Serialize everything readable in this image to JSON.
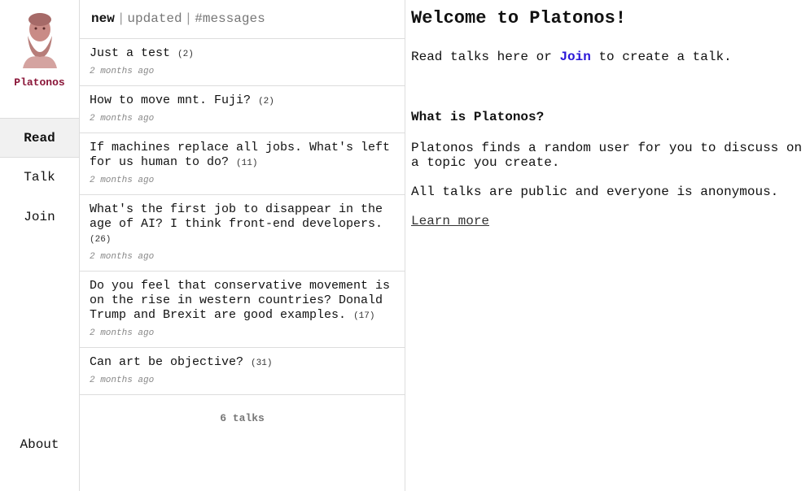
{
  "sidebar": {
    "brand": "Platonos",
    "nav": [
      {
        "label": "Read"
      },
      {
        "label": "Talk"
      },
      {
        "label": "Join"
      }
    ],
    "about": "About"
  },
  "tabs": {
    "new": "new",
    "updated": "updated",
    "messages": "#messages",
    "separator": "|"
  },
  "talks": [
    {
      "title": "Just a test",
      "count": "(2)",
      "time": "2 months ago"
    },
    {
      "title": "How to move mnt. Fuji?",
      "count": "(2)",
      "time": "2 months ago"
    },
    {
      "title": "If machines replace all jobs. What's left for us human to do?",
      "count": "(11)",
      "time": "2 months ago"
    },
    {
      "title": "What's the first job to disappear in the age of AI? I think front-end developers.",
      "count": "(26)",
      "time": "2 months ago"
    },
    {
      "title": "Do you feel that conservative movement is on the rise in western countries? Donald Trump and Brexit are good examples.",
      "count": "(17)",
      "time": "2 months ago"
    },
    {
      "title": "Can art be objective?",
      "count": "(31)",
      "time": "2 months ago"
    }
  ],
  "total": "6 talks",
  "main": {
    "heading": "Welcome to Platonos!",
    "read_pre": "Read talks here or",
    "join_link": "Join",
    "read_post": "to create a talk.",
    "what_heading": "What is Platonos?",
    "what_text": "Platonos finds a random user for you to discuss on a topic you create.",
    "all_text": "All talks are public and everyone is anonymous.",
    "learn_more": "Learn more"
  },
  "colors": {
    "brand": "#8a1538",
    "link": "#2a16d8"
  }
}
